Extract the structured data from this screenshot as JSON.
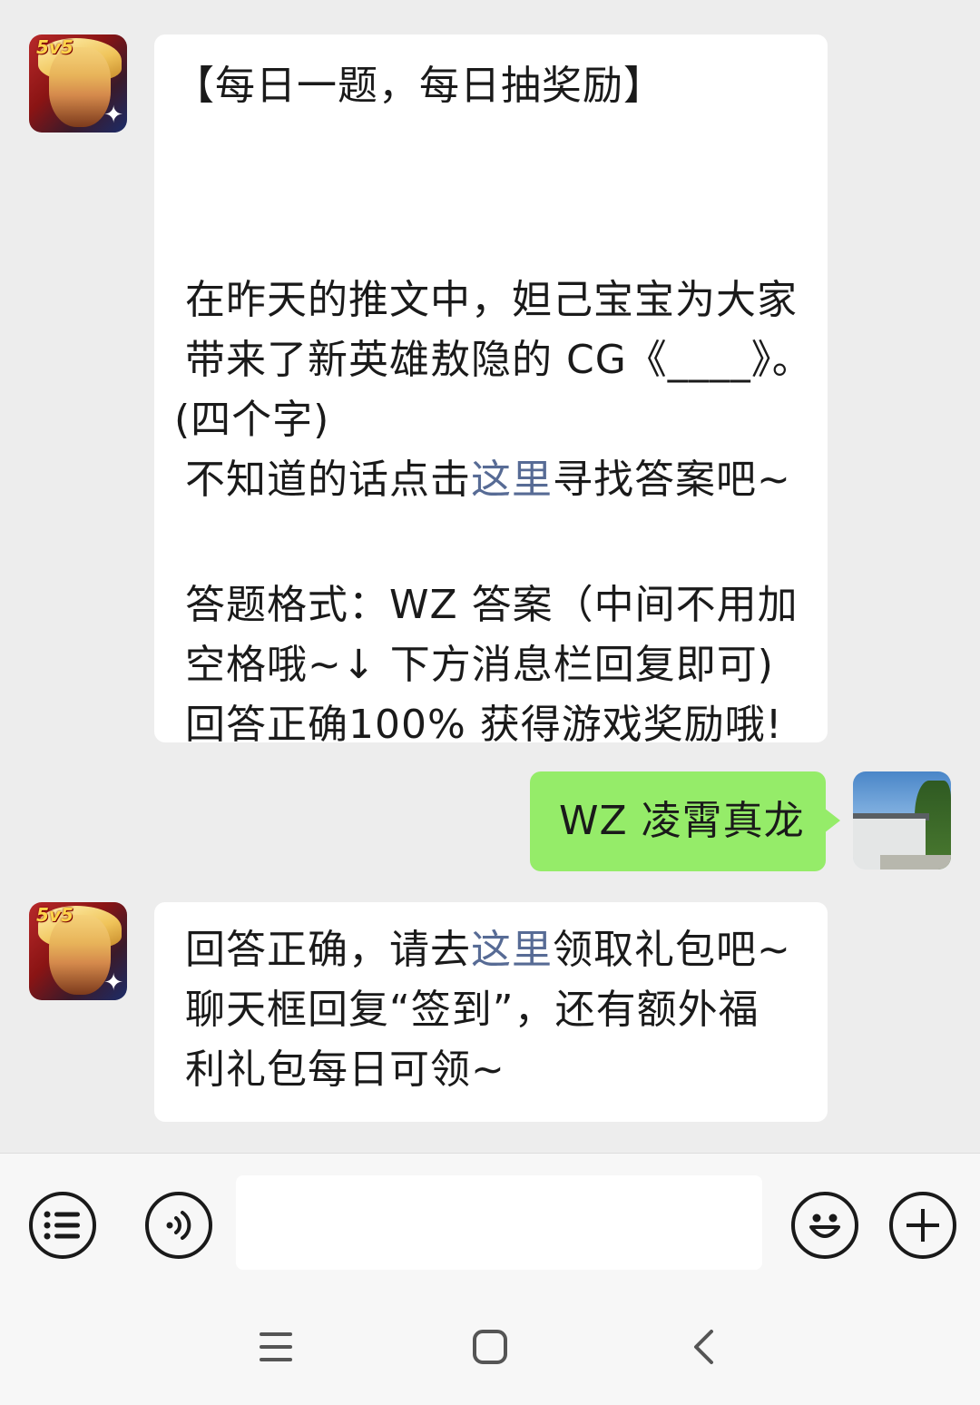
{
  "messages": {
    "m1": {
      "title": "【每日一题，每日抽奖励】",
      "question_lines": [
        "在昨天的推文中，妲己宝宝为大家",
        "带来了新英雄敖隐的 CG《____》。",
        "(四个字)"
      ],
      "hint_prefix": "不知道的话点击",
      "hint_link": "这里",
      "hint_suffix": "寻找答案吧~",
      "format_lines": [
        "答题格式：WZ 答案（中间不用加",
        "空格哦~↓ 下方消息栏回复即可)",
        "回答正确100% 获得游戏奖励哦!"
      ]
    },
    "m2": {
      "text": "WZ 凌霄真龙"
    },
    "m3": {
      "line1_prefix": "回答正确，请去",
      "line1_link": "这里",
      "line1_suffix": "领取礼包吧~",
      "line2": "聊天框回复“签到”，还有额外福",
      "line3": "利礼包每日可领~"
    }
  },
  "avatars": {
    "game_badge": "5v5"
  },
  "colors": {
    "background": "#ededed",
    "link": "#576b95",
    "sent_bubble": "#95ec69"
  },
  "icons": [
    "menu-icon",
    "voice-icon",
    "emoji-icon",
    "plus-icon",
    "nav-menu-icon",
    "nav-home-icon",
    "nav-back-icon"
  ]
}
